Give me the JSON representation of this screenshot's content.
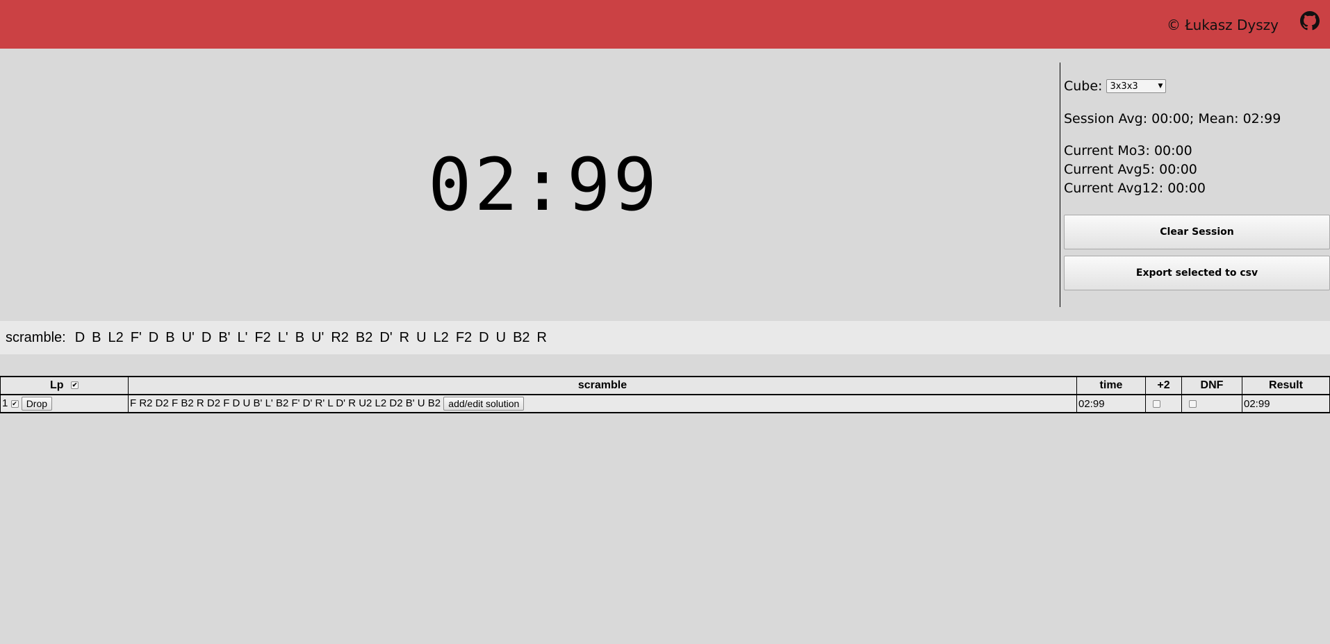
{
  "header": {
    "copyright": "© Łukasz Dyszy",
    "github_icon": "github-icon",
    "color": "#cb4144"
  },
  "timer": {
    "display": "02:99"
  },
  "panel": {
    "cube_label": "Cube:",
    "cube_selected": "3x3x3",
    "session_line": "Session Avg: 00:00; Mean: 02:99",
    "mo3": "Current Mo3: 00:00",
    "avg5": "Current Avg5: 00:00",
    "avg12": "Current Avg12: 00:00",
    "clear_label": "Clear Session",
    "export_label": "Export selected to csv"
  },
  "scramble": {
    "label": "scramble:",
    "moves": [
      "D",
      "B",
      "L2",
      "F'",
      "D",
      "B",
      "U'",
      "D",
      "B'",
      "L'",
      "F2",
      "L'",
      "B",
      "U'",
      "R2",
      "B2",
      "D'",
      "R",
      "U",
      "L2",
      "F2",
      "D",
      "U",
      "B2",
      "R"
    ]
  },
  "table": {
    "headers": {
      "lp": "Lp",
      "scramble": "scramble",
      "time": "time",
      "plus2": "+2",
      "dnf": "DNF",
      "result": "Result"
    },
    "rows": [
      {
        "lp": "1",
        "drop_label": "Drop",
        "scramble": "F R2 D2 F B2 R D2 F D U B' L' B2 F' D' R' L D' R U2 L2 D2 B' U B2",
        "solution_label": "add/edit solution",
        "time": "02:99",
        "result": "02:99"
      }
    ]
  }
}
